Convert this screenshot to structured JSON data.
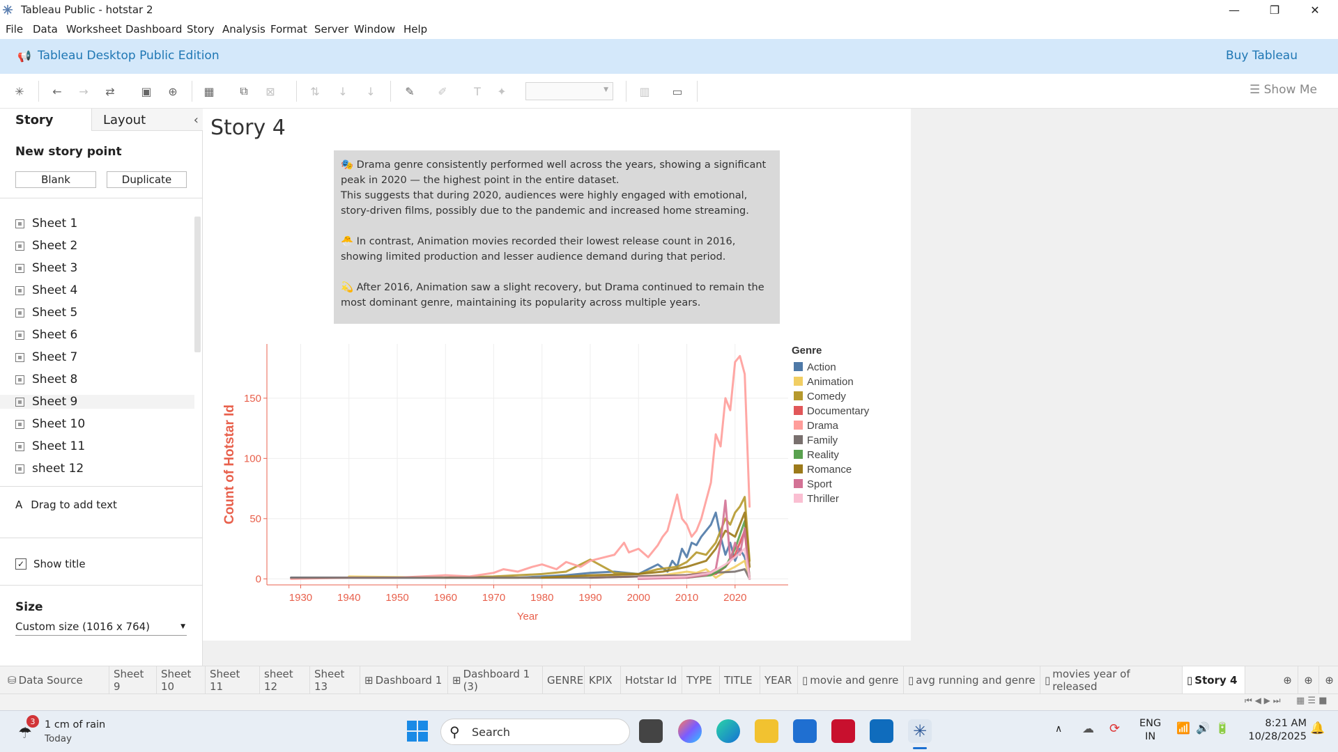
{
  "window": {
    "title": "Tableau Public - hotstar 2",
    "minimize": "—",
    "maximize": "❐",
    "close": "✕"
  },
  "menu": [
    "File",
    "Data",
    "Worksheet",
    "Dashboard",
    "Story",
    "Analysis",
    "Format",
    "Server",
    "Window",
    "Help"
  ],
  "banner": {
    "title": "Tableau Desktop Public Edition",
    "buy": "Buy Tableau"
  },
  "toolbar": {
    "show_me": "Show Me"
  },
  "left": {
    "tab_story": "Story",
    "tab_layout": "Layout",
    "new_story_point": "New story point",
    "blank": "Blank",
    "duplicate": "Duplicate",
    "sheets": [
      "Sheet 1",
      "Sheet 2",
      "Sheet 3",
      "Sheet 4",
      "Sheet 5",
      "Sheet 6",
      "Sheet 7",
      "Sheet 8",
      "Sheet 9",
      "Sheet 10",
      "Sheet 11",
      "sheet 12"
    ],
    "drag_text": "Drag to add text",
    "drag_icon": "A",
    "show_title": "Show title",
    "size_label": "Size",
    "size_value": "Custom size (1016 x 764)"
  },
  "story": {
    "title": "Story 4",
    "annotation": {
      "p1": "🎭 Drama genre consistently performed well across the years, showing a significant peak in 2020 — the highest point in the entire dataset.",
      "p2": "This suggests that during 2020, audiences were highly engaged with emotional, story-driven films, possibly due to the pandemic and increased home streaming.",
      "p3": "🐣 In contrast, Animation movies recorded their lowest release count in 2016, showing limited production and lesser audience demand during that period.",
      "p4": "💫 After 2016, Animation saw a slight recovery, but Drama continued to remain the most dominant genre, maintaining its popularity across multiple years."
    }
  },
  "chart_data": {
    "type": "line",
    "xlabel": "Year",
    "ylabel": "Count of Hotstar Id",
    "xticks": [
      1930,
      1940,
      1950,
      1960,
      1970,
      1980,
      1990,
      2000,
      2010,
      2020
    ],
    "yticks": [
      0,
      50,
      100,
      150
    ],
    "xlim": [
      1923,
      2031
    ],
    "ylim": [
      -5,
      195
    ],
    "legend_title": "Genre",
    "legend_position": "right",
    "grid": true,
    "series": [
      {
        "name": "Action",
        "color": "#4e79a7",
        "x": [
          1928,
          1937,
          1975,
          1980,
          1985,
          1990,
          1995,
          2000,
          2002,
          2004,
          2006,
          2007,
          2008,
          2009,
          2010,
          2011,
          2012,
          2013,
          2014,
          2015,
          2016,
          2017,
          2018,
          2019,
          2020,
          2021,
          2022,
          2023
        ],
        "y": [
          1,
          1,
          1,
          2,
          3,
          5,
          6,
          4,
          8,
          12,
          6,
          15,
          10,
          25,
          18,
          30,
          28,
          35,
          40,
          45,
          55,
          35,
          20,
          30,
          15,
          25,
          18,
          0
        ]
      },
      {
        "name": "Animation",
        "color": "#f1ce63",
        "x": [
          1940,
          1960,
          1980,
          1990,
          2000,
          2005,
          2010,
          2012,
          2014,
          2016,
          2018,
          2020,
          2022,
          2023
        ],
        "y": [
          2,
          1,
          1,
          2,
          2,
          3,
          6,
          5,
          8,
          1,
          6,
          10,
          15,
          0
        ]
      },
      {
        "name": "Comedy",
        "color": "#b6992d",
        "x": [
          1960,
          1970,
          1975,
          1980,
          1985,
          1988,
          1990,
          1995,
          2000,
          2004,
          2008,
          2010,
          2012,
          2014,
          2016,
          2018,
          2019,
          2020,
          2021,
          2022,
          2023
        ],
        "y": [
          1,
          2,
          3,
          4,
          6,
          12,
          16,
          5,
          4,
          8,
          10,
          14,
          22,
          20,
          30,
          50,
          45,
          55,
          60,
          68,
          15
        ]
      },
      {
        "name": "Documentary",
        "color": "#e15759",
        "x": [
          1990,
          2000,
          2010,
          2014,
          2016,
          2018,
          2020,
          2022,
          2023
        ],
        "y": [
          1,
          2,
          3,
          5,
          4,
          10,
          20,
          40,
          0
        ]
      },
      {
        "name": "Drama",
        "color": "#ff9d9a",
        "x": [
          1928,
          1940,
          1950,
          1955,
          1960,
          1965,
          1970,
          1972,
          1975,
          1978,
          1980,
          1983,
          1985,
          1988,
          1990,
          1993,
          1995,
          1997,
          1998,
          2000,
          2002,
          2004,
          2005,
          2006,
          2007,
          2008,
          2009,
          2010,
          2011,
          2012,
          2013,
          2014,
          2015,
          2016,
          2017,
          2018,
          2019,
          2020,
          2021,
          2022,
          2023
        ],
        "y": [
          0,
          1,
          1,
          2,
          3,
          2,
          5,
          8,
          6,
          10,
          12,
          8,
          14,
          10,
          15,
          18,
          20,
          30,
          22,
          25,
          18,
          28,
          35,
          40,
          55,
          70,
          50,
          45,
          35,
          40,
          50,
          65,
          80,
          120,
          110,
          150,
          140,
          180,
          185,
          170,
          60
        ]
      },
      {
        "name": "Family",
        "color": "#79706e",
        "x": [
          1928,
          1937,
          1980,
          1990,
          2000,
          2010,
          2015,
          2020,
          2022,
          2023
        ],
        "y": [
          1,
          1,
          1,
          1,
          2,
          3,
          5,
          6,
          8,
          0
        ]
      },
      {
        "name": "Reality",
        "color": "#59a14f",
        "x": [
          2010,
          2015,
          2018,
          2020,
          2022,
          2023
        ],
        "y": [
          1,
          3,
          10,
          25,
          48,
          0
        ]
      },
      {
        "name": "Romance",
        "color": "#9c7a1a",
        "x": [
          1980,
          1990,
          2000,
          2005,
          2010,
          2014,
          2016,
          2018,
          2020,
          2022,
          2023
        ],
        "y": [
          1,
          3,
          4,
          6,
          10,
          15,
          25,
          40,
          35,
          55,
          10
        ]
      },
      {
        "name": "Sport",
        "color": "#d37295",
        "x": [
          2000,
          2010,
          2014,
          2016,
          2017,
          2018,
          2019,
          2020,
          2021,
          2022,
          2023
        ],
        "y": [
          0,
          1,
          3,
          8,
          30,
          65,
          15,
          30,
          20,
          42,
          0
        ]
      },
      {
        "name": "Thriller",
        "color": "#fabfd2",
        "x": [
          2000,
          2010,
          2015,
          2018,
          2020,
          2022,
          2023
        ],
        "y": [
          1,
          2,
          5,
          12,
          18,
          25,
          0
        ]
      }
    ]
  },
  "tabs": [
    "Data Source",
    "Sheet 9",
    "Sheet 10",
    "Sheet 11",
    "sheet 12",
    "Sheet 13",
    "Dashboard 1",
    "Dashboard 1 (3)",
    "GENRE",
    "KPIX",
    "Hotstar Id",
    "TYPE",
    "TITLE",
    "YEAR",
    "movie and genre",
    "avg running and genre",
    "movies year of released",
    "Story 4"
  ],
  "taskbar": {
    "weather_badge": "3",
    "weather_main": "1 cm of rain",
    "weather_sub": "Today",
    "search": "Search",
    "lang1": "ENG",
    "lang2": "IN",
    "time": "8:21 AM",
    "date": "10/28/2025"
  }
}
